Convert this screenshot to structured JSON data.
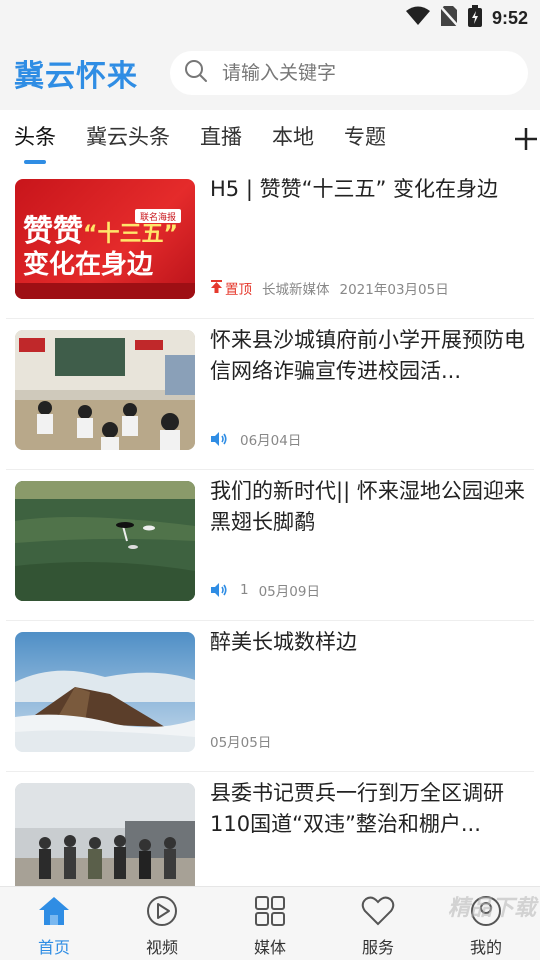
{
  "status_bar": {
    "time": "9:52"
  },
  "header": {
    "logo": "冀云怀来",
    "search_placeholder": "请输入关键字"
  },
  "tabs": [
    "头条",
    "冀云头条",
    "直播",
    "本地",
    "专题"
  ],
  "news": [
    {
      "title": "H5 | 赞赞“十三五” 变化在身边",
      "pinned": true,
      "pin_label": "置顶",
      "source": "长城新媒体",
      "date": "2021年03月05日",
      "audio": false,
      "count": "",
      "thumb_text_1": "赞赞",
      "thumb_text_2": "“十三五”",
      "thumb_text_3": "变化在身边",
      "thumb_badge": "联名海报"
    },
    {
      "title": "怀来县沙城镇府前小学开展预防电信网络诈骗宣传进校园活...",
      "pinned": false,
      "source": "",
      "date": "06月04日",
      "audio": true,
      "count": ""
    },
    {
      "title": "我们的新时代|| 怀来湿地公园迎来黑翅长脚鹬",
      "pinned": false,
      "source": "",
      "date": "05月09日",
      "audio": true,
      "count": "1"
    },
    {
      "title": "醉美长城数样边",
      "pinned": false,
      "source": "",
      "date": "05月05日",
      "audio": false,
      "count": ""
    },
    {
      "title": "县委书记贾兵一行到万全区调研110国道“双违”整治和棚户...",
      "pinned": false,
      "source": "",
      "date": "",
      "audio": false,
      "count": ""
    }
  ],
  "bottom_nav": [
    "首页",
    "视频",
    "媒体",
    "服务",
    "我的"
  ],
  "watermark": "精品下载",
  "colors": {
    "accent": "#2f8de4",
    "pin": "#e5392d"
  }
}
